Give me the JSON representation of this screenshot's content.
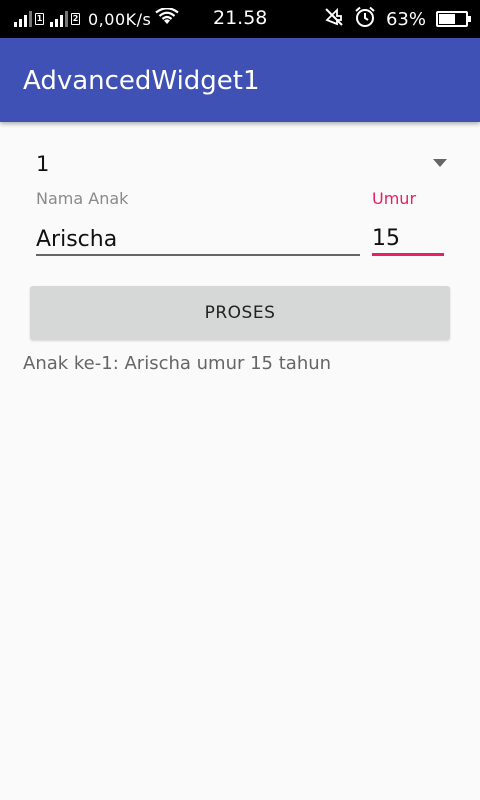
{
  "status_bar": {
    "sim1": "1",
    "sim2": "2",
    "net_speed": "0,00K/s",
    "time": "21.58",
    "battery_percent": "63%",
    "battery_level": 0.63,
    "icons": [
      "signal-icon",
      "signal-icon",
      "wifi-icon",
      "silent-icon",
      "alarm-icon",
      "battery-icon"
    ]
  },
  "app_bar": {
    "title": "AdvancedWidget1",
    "color": "#3f51b5"
  },
  "form": {
    "spinner_value": "1",
    "nama_label": "Nama Anak",
    "nama_value": "Arischa",
    "umur_label": "Umur",
    "umur_value": "15",
    "accent_color": "#e91e63"
  },
  "button": {
    "label": "PROSES"
  },
  "result": {
    "text": "Anak ke-1: Arischa umur 15 tahun"
  }
}
